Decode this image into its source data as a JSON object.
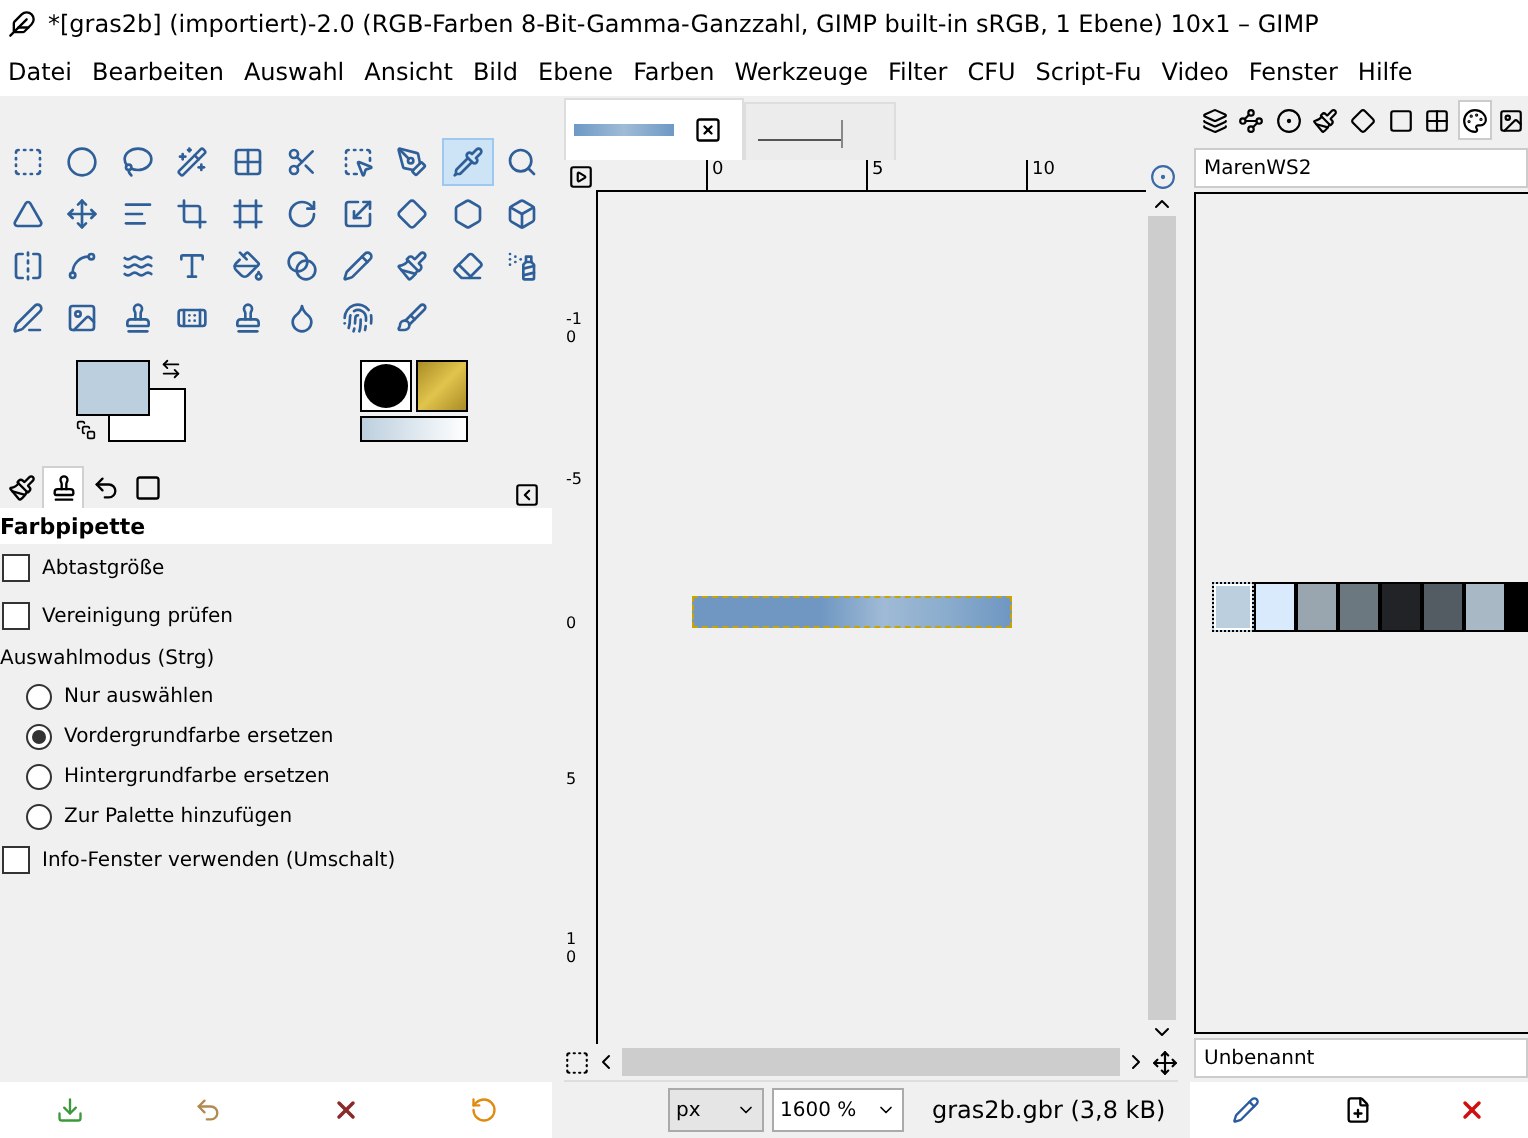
{
  "window": {
    "title": "*[gras2b] (importiert)-2.0 (RGB-Farben 8-Bit-Gamma-Ganzzahl, GIMP built-in sRGB, 1 Ebene) 10x1 – GIMP"
  },
  "menu": [
    "Datei",
    "Bearbeiten",
    "Auswahl",
    "Ansicht",
    "Bild",
    "Ebene",
    "Farben",
    "Werkzeuge",
    "Filter",
    "CFU",
    "Script-Fu",
    "Video",
    "Fenster",
    "Hilfe"
  ],
  "tools": [
    {
      "selected": false
    },
    {
      "selected": false
    },
    {
      "selected": false
    },
    {
      "selected": false
    },
    {
      "selected": false
    },
    {
      "selected": false
    },
    {
      "selected": false
    },
    {
      "selected": false
    },
    {
      "selected": true
    },
    {
      "selected": false
    },
    {
      "selected": false
    },
    {
      "selected": false
    },
    {
      "selected": false
    },
    {
      "selected": false
    },
    {
      "selected": false
    },
    {
      "selected": false
    },
    {
      "selected": false
    },
    {
      "selected": false
    },
    {
      "selected": false
    },
    {
      "selected": false
    },
    {
      "selected": false
    },
    {
      "selected": false
    },
    {
      "selected": false
    },
    {
      "selected": false
    },
    {
      "selected": false
    },
    {
      "selected": false
    },
    {
      "selected": false
    },
    {
      "selected": false
    },
    {
      "selected": false
    },
    {
      "selected": false
    },
    {
      "selected": false
    },
    {
      "selected": false
    },
    {
      "selected": false
    },
    {
      "selected": false
    },
    {
      "selected": false
    },
    {
      "selected": false
    },
    {
      "selected": false
    },
    {
      "selected": false
    }
  ],
  "colors": [
    {
      "kind": "foreground",
      "color": "#bccfde"
    },
    {
      "kind": "background",
      "color": "#ffffff"
    }
  ],
  "dock_tabs": [
    {
      "selected": false
    },
    {
      "selected": true
    },
    {
      "selected": false
    },
    {
      "selected": false
    }
  ],
  "tool_options": {
    "title": "Farbpipette",
    "items": [
      {
        "kind": "checkbox",
        "label": "Abtastgröße",
        "checked": false
      },
      {
        "kind": "checkbox",
        "label": "Vereinigung prüfen",
        "checked": false
      },
      {
        "kind": "heading",
        "label": "Auswahlmodus (Strg)"
      },
      {
        "kind": "radio",
        "label": "Nur auswählen",
        "selected": false
      },
      {
        "kind": "radio",
        "label": "Vordergrundfarbe ersetzen",
        "selected": true
      },
      {
        "kind": "radio",
        "label": "Hintergrundfarbe ersetzen",
        "selected": false
      },
      {
        "kind": "radio",
        "label": "Zur Palette hinzufügen",
        "selected": false
      },
      {
        "kind": "checkbox",
        "label": "Info-Fenster verwenden (Umschalt)",
        "checked": false
      }
    ]
  },
  "image_tabs": [
    {
      "selected": true
    },
    {
      "selected": false
    }
  ],
  "ruler": {
    "horizontal": [
      "0",
      "5",
      "10"
    ],
    "vertical": [
      "-10",
      "-5",
      "0",
      "5",
      "10"
    ]
  },
  "status_bar": {
    "unit": "px",
    "zoom": "1600 %",
    "file": "gras2b.gbr (3,8 kB)"
  },
  "right_dock": {
    "tabs": [
      {
        "selected": false
      },
      {
        "selected": false
      },
      {
        "selected": false
      },
      {
        "selected": false
      },
      {
        "selected": false
      },
      {
        "selected": false
      },
      {
        "selected": false
      },
      {
        "selected": true
      },
      {
        "selected": false
      }
    ],
    "palette_name": "MarenWS2",
    "swatches": [
      {
        "color": "#bccfde",
        "selected": true
      },
      {
        "color": "#d8eafb",
        "selected": false
      },
      {
        "color": "#99a6b0",
        "selected": false
      },
      {
        "color": "#6c7880",
        "selected": false
      },
      {
        "color": "#212326",
        "selected": false
      },
      {
        "color": "#535c63",
        "selected": false
      },
      {
        "color": "#a8b8c5",
        "selected": false
      },
      {
        "color": "#000000",
        "selected": false
      }
    ],
    "color_name": "Unbenannt"
  }
}
